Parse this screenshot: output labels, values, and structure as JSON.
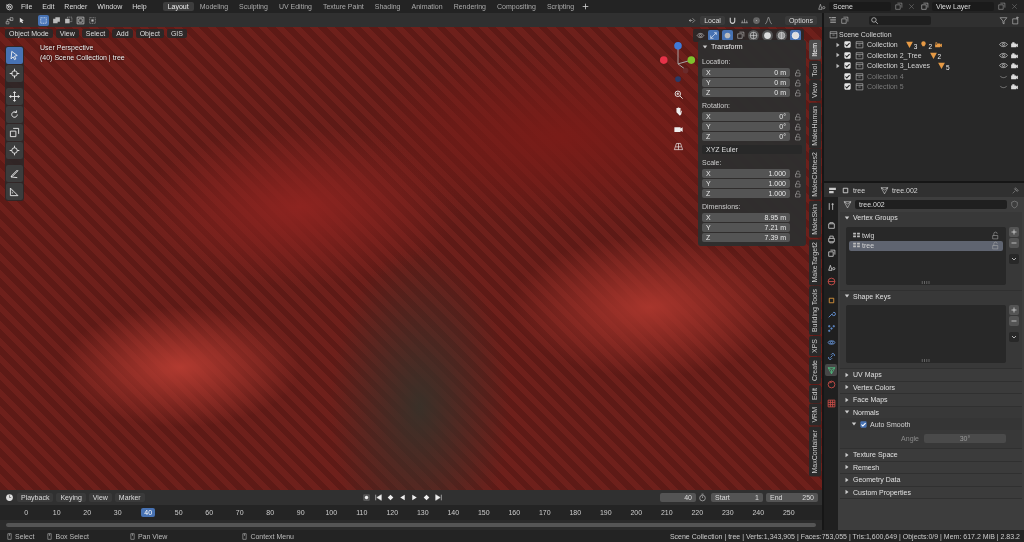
{
  "menu": [
    "File",
    "Edit",
    "Render",
    "Window",
    "Help"
  ],
  "workspaces": [
    {
      "label": "Layout",
      "selected": true
    },
    {
      "label": "Modeling",
      "selected": false
    },
    {
      "label": "Sculpting",
      "selected": false
    },
    {
      "label": "UV Editing",
      "selected": false
    },
    {
      "label": "Texture Paint",
      "selected": false
    },
    {
      "label": "Shading",
      "selected": false
    },
    {
      "label": "Animation",
      "selected": false
    },
    {
      "label": "Rendering",
      "selected": false
    },
    {
      "label": "Compositing",
      "selected": false
    },
    {
      "label": "Scripting",
      "selected": false
    }
  ],
  "scene": {
    "value": "Scene"
  },
  "view_layer": {
    "value": "View Layer"
  },
  "tool_header": {
    "orientation": "Local",
    "options": "Options"
  },
  "viewport": {
    "mode": "Object Mode",
    "menus": [
      "View",
      "Select",
      "Add",
      "Object",
      "GIS"
    ],
    "perspective": "User Perspective",
    "context": "(40) Scene Collection | tree",
    "tools": [
      {
        "kind": "select",
        "selected": true
      },
      {
        "kind": "cursor",
        "selected": false
      },
      {
        "kind": "move",
        "selected": false
      },
      {
        "kind": "rotate",
        "selected": false
      },
      {
        "kind": "scale",
        "selected": false
      },
      {
        "kind": "transform",
        "selected": false
      },
      {
        "kind": "annotate",
        "selected": false
      },
      {
        "kind": "measure",
        "selected": false
      }
    ],
    "shading": [
      {
        "kind": "wireframe",
        "selected": false
      },
      {
        "kind": "solid",
        "selected": false
      },
      {
        "kind": "material",
        "selected": false
      },
      {
        "kind": "rendered",
        "selected": true
      }
    ]
  },
  "transform_panel": {
    "title": "Transform",
    "sections": [
      {
        "label": "Location:",
        "rows": [
          {
            "axis": "X",
            "value": "0 m",
            "lock": true
          },
          {
            "axis": "Y",
            "value": "0 m",
            "lock": true
          },
          {
            "axis": "Z",
            "value": "0 m",
            "lock": true
          }
        ]
      },
      {
        "label": "Rotation:",
        "rows": [
          {
            "axis": "X",
            "value": "0°",
            "lock": true
          },
          {
            "axis": "Y",
            "value": "0°",
            "lock": true
          },
          {
            "axis": "Z",
            "value": "0°",
            "lock": true
          }
        ],
        "mode": "XYZ Euler"
      },
      {
        "label": "Scale:",
        "rows": [
          {
            "axis": "X",
            "value": "1.000",
            "lock": true
          },
          {
            "axis": "Y",
            "value": "1.000",
            "lock": true
          },
          {
            "axis": "Z",
            "value": "1.000",
            "lock": true
          }
        ]
      },
      {
        "label": "Dimensions:",
        "rows": [
          {
            "axis": "X",
            "value": "8.95 m"
          },
          {
            "axis": "Y",
            "value": "7.21 m"
          },
          {
            "axis": "Z",
            "value": "7.39 m"
          }
        ]
      }
    ]
  },
  "sidebar_tabs": [
    {
      "label": "Item",
      "selected": true
    },
    {
      "label": "Tool",
      "selected": false
    },
    {
      "label": "View",
      "selected": false
    },
    {
      "label": "MakeHuman",
      "selected": false
    },
    {
      "label": "MakeClothes2",
      "selected": false
    },
    {
      "label": "MakeSkin",
      "selected": false
    },
    {
      "label": "MakeTarget2",
      "selected": false
    },
    {
      "label": "Building Tools",
      "selected": false
    },
    {
      "label": "XPS",
      "selected": false
    },
    {
      "label": "Create",
      "selected": false
    },
    {
      "label": "Edit",
      "selected": false
    },
    {
      "label": "VRM",
      "selected": false
    },
    {
      "label": "MaxContainer",
      "selected": false
    }
  ],
  "timeline": {
    "menus": [
      "Playback",
      "Keying",
      "View",
      "Marker"
    ],
    "current_frame": "40",
    "start_label": "Start",
    "start": "1",
    "end_label": "End",
    "end": "250",
    "ticks": [
      {
        "label": "0",
        "selected": false
      },
      {
        "label": "10",
        "selected": false
      },
      {
        "label": "20",
        "selected": false
      },
      {
        "label": "30",
        "selected": false
      },
      {
        "label": "40",
        "selected": true
      },
      {
        "label": "50",
        "selected": false
      },
      {
        "label": "60",
        "selected": false
      },
      {
        "label": "70",
        "selected": false
      },
      {
        "label": "80",
        "selected": false
      },
      {
        "label": "90",
        "selected": false
      },
      {
        "label": "100",
        "selected": false
      },
      {
        "label": "110",
        "selected": false
      },
      {
        "label": "120",
        "selected": false
      },
      {
        "label": "130",
        "selected": false
      },
      {
        "label": "140",
        "selected": false
      },
      {
        "label": "150",
        "selected": false
      },
      {
        "label": "160",
        "selected": false
      },
      {
        "label": "170",
        "selected": false
      },
      {
        "label": "180",
        "selected": false
      },
      {
        "label": "190",
        "selected": false
      },
      {
        "label": "200",
        "selected": false
      },
      {
        "label": "210",
        "selected": false
      },
      {
        "label": "220",
        "selected": false
      },
      {
        "label": "230",
        "selected": false
      },
      {
        "label": "240",
        "selected": false
      },
      {
        "label": "250",
        "selected": false
      }
    ]
  },
  "outliner": {
    "root": "Scene Collection",
    "collections": [
      {
        "name": "Collection",
        "checked": true,
        "visible": true,
        "expandable": true,
        "badges": [
          {
            "kind": "mesh",
            "count": "3"
          },
          {
            "kind": "light",
            "count": "2"
          },
          {
            "kind": "camera"
          }
        ]
      },
      {
        "name": "Collection 2_Tree",
        "checked": true,
        "visible": true,
        "expandable": true,
        "badges": [
          {
            "kind": "mesh",
            "count": "2"
          }
        ]
      },
      {
        "name": "Collection 3_Leaves",
        "checked": true,
        "visible": true,
        "expandable": true,
        "badges": [
          {
            "kind": "mesh",
            "count": "5"
          }
        ]
      },
      {
        "name": "Collection 4",
        "checked": true,
        "visible": false,
        "expandable": false
      },
      {
        "name": "Collection 5",
        "checked": true,
        "visible": false,
        "expandable": false
      }
    ]
  },
  "properties": {
    "object": "tree",
    "mesh": "tree.002",
    "datablock": "tree.002",
    "tabs": [
      {
        "kind": "tool",
        "selected": false
      },
      {
        "kind": "render",
        "selected": false
      },
      {
        "kind": "output",
        "selected": false
      },
      {
        "kind": "view_layer",
        "selected": false
      },
      {
        "kind": "scene",
        "selected": false
      },
      {
        "kind": "world",
        "selected": false
      },
      {
        "kind": "object",
        "selected": false
      },
      {
        "kind": "modifiers",
        "selected": false
      },
      {
        "kind": "particles",
        "selected": false
      },
      {
        "kind": "physics",
        "selected": false
      },
      {
        "kind": "constraints",
        "selected": false
      },
      {
        "kind": "data",
        "selected": true
      },
      {
        "kind": "material",
        "selected": false
      },
      {
        "kind": "texture",
        "selected": false
      }
    ],
    "panels": [
      {
        "kind": "list",
        "title": "Vertex Groups",
        "expanded": true,
        "items": [
          {
            "name": "twig",
            "selected": false
          },
          {
            "name": "tree",
            "selected": true
          }
        ]
      },
      {
        "kind": "list",
        "title": "Shape Keys",
        "expanded": true
      },
      {
        "kind": "plain",
        "title": "UV Maps",
        "expanded": false
      },
      {
        "kind": "plain",
        "title": "Vertex Colors",
        "expanded": false
      },
      {
        "kind": "plain",
        "title": "Face Maps",
        "expanded": false
      },
      {
        "kind": "normals",
        "title": "Normals",
        "expanded": true,
        "auto_smooth": {
          "label": "Auto Smooth",
          "checked": true
        },
        "angle_label": "Angle",
        "angle": "30°"
      },
      {
        "kind": "plain",
        "title": "Texture Space",
        "expanded": false
      },
      {
        "kind": "plain",
        "title": "Remesh",
        "expanded": false
      },
      {
        "kind": "plain",
        "title": "Geometry Data",
        "expanded": false
      },
      {
        "kind": "plain",
        "title": "Custom Properties",
        "expanded": false
      }
    ]
  },
  "status_bar": {
    "hints": [
      "Select",
      "Box Select",
      "Pan View",
      "Context Menu"
    ],
    "stats": "Scene Collection | tree | Verts:1,343,905 | Faces:753,055 | Tris:1,600,649 | Objects:0/9 | Mem: 617.2 MiB | 2.83.2"
  }
}
